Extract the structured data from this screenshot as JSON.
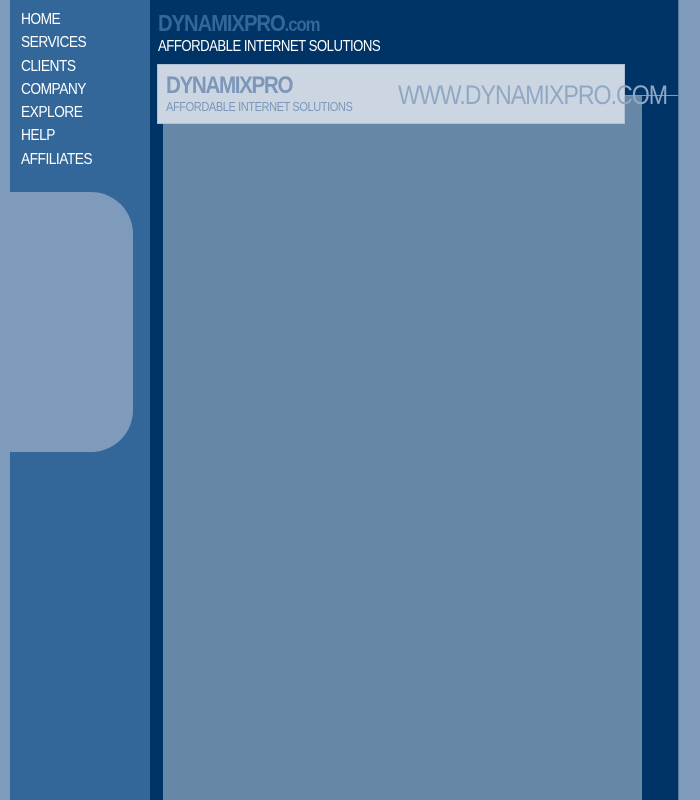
{
  "nav": {
    "items": [
      {
        "label": "HOME"
      },
      {
        "label": "SERVICES"
      },
      {
        "label": "CLIENTS"
      },
      {
        "label": "COMPANY"
      },
      {
        "label": "EXPLORE"
      },
      {
        "label": "HELP"
      },
      {
        "label": "AFFILIATES"
      }
    ]
  },
  "header": {
    "brand_main": "DYNAMIXPRO",
    "brand_suffix": ".com",
    "tagline": "AFFORDABLE INTERNET SOLUTIONS"
  },
  "banner": {
    "brand": "DYNAMIXPRO",
    "tagline": "AFFORDABLE INTERNET SOLUTIONS",
    "url": "WWW.DYNAMIXPRO.COM"
  },
  "colors": {
    "sidebar": "#336699",
    "dark_navy": "#003366",
    "light_blue": "#7f9bbc",
    "banner_bg": "#ccd6e2",
    "content_bg": "#6787a7"
  }
}
